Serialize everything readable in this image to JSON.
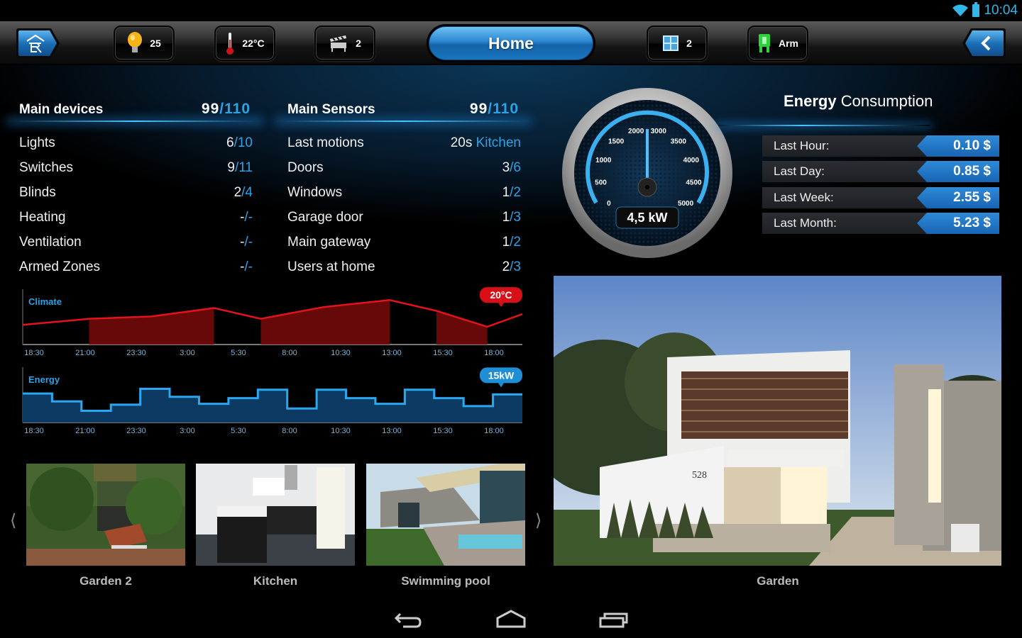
{
  "status_bar": {
    "time": "10:04",
    "icons": [
      "wifi-icon",
      "battery-icon"
    ]
  },
  "toolbar": {
    "logo_icon": "home-logo-icon",
    "buttons": [
      {
        "icon": "light-bulb-icon",
        "label": "25"
      },
      {
        "icon": "thermometer-icon",
        "label": "22°C"
      },
      {
        "icon": "clapperboard-icon",
        "label": "2"
      },
      {
        "icon": "window-icon",
        "label": "2"
      },
      {
        "icon": "alarm-arm-icon",
        "label": "Arm"
      }
    ],
    "active_tab": "Home",
    "back_icon": "chevron-left-icon"
  },
  "main_devices": {
    "title": "Main devices",
    "count_on": "99",
    "count_total": "/110",
    "rows": [
      {
        "label": "Lights",
        "on": "6",
        "total": "/10"
      },
      {
        "label": "Switches",
        "on": "9",
        "total": "/11"
      },
      {
        "label": "Blinds",
        "on": "2",
        "total": "/4"
      },
      {
        "label": "Heating",
        "on": "-",
        "total": "/-"
      },
      {
        "label": "Ventilation",
        "on": "-",
        "total": "/-"
      },
      {
        "label": "Armed Zones",
        "on": "-",
        "total": "/-"
      }
    ]
  },
  "main_sensors": {
    "title": "Main Sensors",
    "count_on": "99",
    "count_total": "/110",
    "rows": [
      {
        "label": "Last motions",
        "on": "20s ",
        "total": "Kitchen"
      },
      {
        "label": "Doors",
        "on": "3",
        "total": "/6"
      },
      {
        "label": "Windows",
        "on": "1",
        "total": "/2"
      },
      {
        "label": "Garage door",
        "on": "1",
        "total": "/3"
      },
      {
        "label": "Main gateway",
        "on": "1",
        "total": "/2"
      },
      {
        "label": "Users at home",
        "on": "2",
        "total": "/3"
      }
    ]
  },
  "gauge": {
    "readout": "4,5 kW",
    "ticks": [
      "0",
      "500",
      "1000",
      "1500",
      "2000",
      "3000",
      "3500",
      "4000",
      "4500",
      "5000"
    ],
    "needle_fraction": 0.5
  },
  "energy_consumption": {
    "title_bold": "Energy",
    "title_rest": " Consumption",
    "rows": [
      {
        "label": "Last Hour:",
        "value": "0.10 $"
      },
      {
        "label": "Last Day:",
        "value": "0.85 $"
      },
      {
        "label": "Last Week:",
        "value": "2.55 $"
      },
      {
        "label": "Last Month:",
        "value": "5.23 $"
      }
    ]
  },
  "chart_data": [
    {
      "type": "area",
      "title": "Climate",
      "x_ticks": [
        "18:30",
        "21:00",
        "23:30",
        "3:00",
        "5:30",
        "8:00",
        "10:30",
        "13:00",
        "15:30",
        "18:00"
      ],
      "x": [
        0,
        1.7,
        3.3,
        4.9,
        6.1,
        7.7,
        9.4,
        10.6,
        11.9,
        12.8
      ],
      "values": [
        0.42,
        0.55,
        0.6,
        0.78,
        0.55,
        0.8,
        0.95,
        0.72,
        0.38,
        0.65
      ],
      "callout": "20°C",
      "color": "#e3131b",
      "ylim": [
        0,
        1
      ]
    },
    {
      "type": "area",
      "title": "Energy",
      "x_ticks": [
        "18:30",
        "21:00",
        "23:30",
        "3:00",
        "5:30",
        "8:00",
        "10:30",
        "13:00",
        "15:30",
        "18:00"
      ],
      "steps": [
        0.62,
        0.45,
        0.25,
        0.38,
        0.72,
        0.55,
        0.4,
        0.52,
        0.7,
        0.3,
        0.7,
        0.52,
        0.4,
        0.7,
        0.52,
        0.35,
        0.6
      ],
      "callout": "15kW",
      "color": "#29a8f0",
      "ylim": [
        0,
        1
      ]
    }
  ],
  "gallery": {
    "prev_icon": "chevron-left-icon",
    "next_icon": "chevron-right-icon",
    "items": [
      {
        "label": "Garden 2"
      },
      {
        "label": "Kitchen"
      },
      {
        "label": "Swimming pool"
      }
    ],
    "featured": {
      "label": "Garden",
      "house_number": "528"
    }
  },
  "nav_bar": {
    "icons": [
      "back-icon",
      "home-icon",
      "recent-apps-icon"
    ]
  }
}
